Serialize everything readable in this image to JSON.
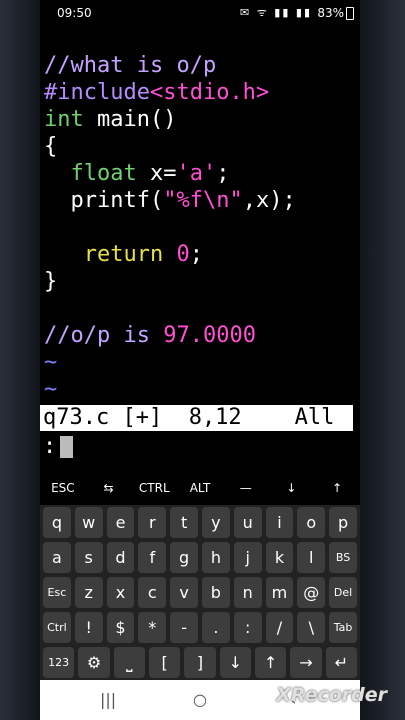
{
  "status": {
    "time": "09:50",
    "icons": "✉ ᯤ ▮▮ ▮▮",
    "battery": "83%"
  },
  "code": {
    "l1": "//what is o/p",
    "l2_a": "#include",
    "l2_b": "<stdio.h>",
    "l3_a": "int",
    "l3_b": " main()",
    "l4": "{",
    "l5_a": "  ",
    "l5_b": "float",
    "l5_c": " x=",
    "l5_d": "'a'",
    "l5_e": ";",
    "l6_a": "  printf(",
    "l6_b": "\"%f\\n\"",
    "l6_c": ",x);",
    "l8_a": "   ",
    "l8_b": "return",
    "l8_c": " ",
    "l8_d": "0",
    "l8_e": ";",
    "l9": "}",
    "l11_a": "//o/p is ",
    "l11_b": "97.0000",
    "tilde": "~"
  },
  "vim": {
    "status": "q73.c [+]  8,12    All",
    "cmd": ":"
  },
  "extra_keys": [
    "ESC",
    "⇆",
    "CTRL",
    "ALT",
    "—",
    "↓",
    "↑"
  ],
  "keyboard": {
    "row1": [
      "q",
      "w",
      "e",
      "r",
      "t",
      "y",
      "u",
      "i",
      "o",
      "p"
    ],
    "row2": [
      "a",
      "s",
      "d",
      "f",
      "g",
      "h",
      "j",
      "k",
      "l",
      "BS"
    ],
    "row3": [
      "Esc",
      "z",
      "x",
      "c",
      "v",
      "b",
      "n",
      "m",
      "@",
      "Del"
    ],
    "row4": [
      "Ctrl",
      "!",
      "$",
      "*",
      "-",
      ".",
      ":",
      "/",
      "\\",
      "Tab"
    ],
    "row5": [
      "123",
      "⚙",
      "⎵",
      "[",
      "]",
      "↓",
      "↑",
      "→",
      "↵"
    ]
  },
  "navbar": {
    "recents": "|||",
    "home": "○",
    "back": "‹"
  },
  "watermark": "XRecorder"
}
